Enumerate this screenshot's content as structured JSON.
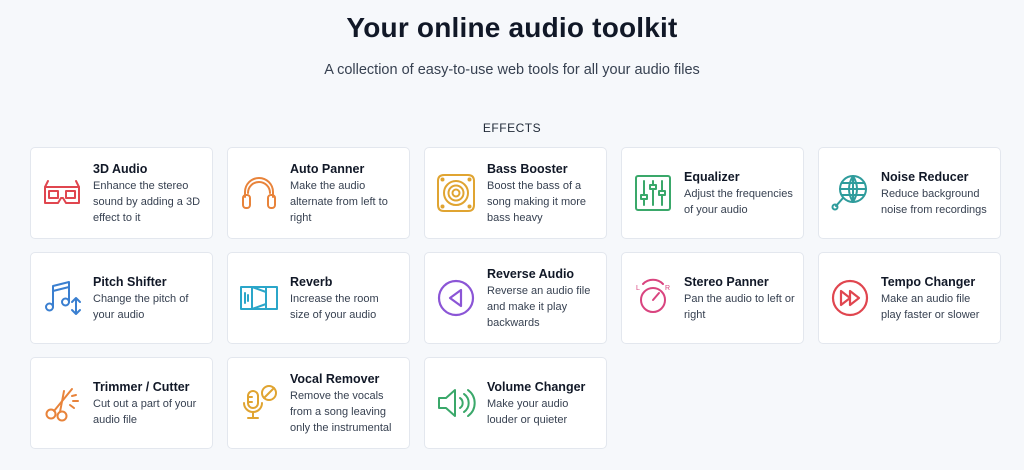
{
  "header": {
    "title": "Your online audio toolkit",
    "subtitle": "A collection of easy-to-use web tools for all your audio files"
  },
  "section": {
    "heading": "EFFECTS"
  },
  "tools": [
    {
      "title": "3D Audio",
      "desc": "Enhance the stereo sound by adding a 3D effect to it",
      "icon": "3d-glasses-icon",
      "color": "#e0464f"
    },
    {
      "title": "Auto Panner",
      "desc": "Make the audio alternate from left to right",
      "icon": "headphones-icon",
      "color": "#e8833a"
    },
    {
      "title": "Bass Booster",
      "desc": "Boost the bass of a song making it more bass heavy",
      "icon": "speaker-icon",
      "color": "#e0a431"
    },
    {
      "title": "Equalizer",
      "desc": "Adjust the frequencies of your audio",
      "icon": "equalizer-sliders-icon",
      "color": "#3aa86a"
    },
    {
      "title": "Noise Reducer",
      "desc": "Reduce background noise from recordings",
      "icon": "globe-microphone-icon",
      "color": "#2f9c9c"
    },
    {
      "title": "Pitch Shifter",
      "desc": "Change the pitch of your audio",
      "icon": "music-note-icon",
      "color": "#3a7fd0"
    },
    {
      "title": "Reverb",
      "desc": "Increase the room size of your audio",
      "icon": "room-icon",
      "color": "#2ba6c9"
    },
    {
      "title": "Reverse Audio",
      "desc": "Reverse an audio file and make it play backwards",
      "icon": "reverse-play-icon",
      "color": "#8b55d6"
    },
    {
      "title": "Stereo Panner",
      "desc": "Pan the audio to left or right",
      "icon": "pan-knob-icon",
      "color": "#d9447f"
    },
    {
      "title": "Tempo Changer",
      "desc": "Make an audio file play faster or slower",
      "icon": "fast-forward-icon",
      "color": "#e0464f"
    },
    {
      "title": "Trimmer / Cutter",
      "desc": "Cut out a part of your audio file",
      "icon": "scissors-icon",
      "color": "#e8833a"
    },
    {
      "title": "Vocal Remover",
      "desc": "Remove the vocals from a song leaving only the instrumental",
      "icon": "muted-microphone-icon",
      "color": "#e0a431"
    },
    {
      "title": "Volume Changer",
      "desc": "Make your audio louder or quieter",
      "icon": "volume-icon",
      "color": "#3aa86a"
    }
  ]
}
